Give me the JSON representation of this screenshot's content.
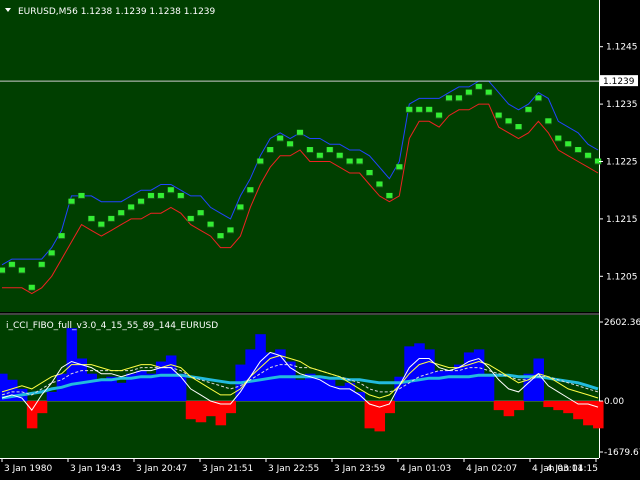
{
  "main": {
    "symbol_title": "EURUSD,M56  1.1238 1.1239 1.1238 1.1239",
    "current_price_label": "1.1239",
    "current_price": 1.1239,
    "price_ticks": [
      {
        "value": 1.1245,
        "label": "1.1245"
      },
      {
        "value": 1.1235,
        "label": "1.1235"
      },
      {
        "value": 1.1225,
        "label": "1.1225"
      },
      {
        "value": 1.1215,
        "label": "1.1215"
      },
      {
        "value": 1.1205,
        "label": "1.1205"
      }
    ]
  },
  "indicator": {
    "title": "i_CCI_FIBO_full_v3.0_4_15_55_89_144_EURUSD",
    "ticks": [
      {
        "value": 2602.36,
        "label": "2602.36"
      },
      {
        "value": 0.0,
        "label": "0.00"
      },
      {
        "value": -1679.67,
        "label": "-1679.67"
      }
    ]
  },
  "time_ticks": [
    "3 Jan 1980",
    "3 Jan 19:43",
    "3 Jan 20:47",
    "3 Jan 21:51",
    "3 Jan 22:55",
    "3 Jan 23:59",
    "4 Jan 01:03",
    "4 Jan 02:07",
    "4 Jan 03:11",
    "4 Jan 04:15"
  ],
  "colors": {
    "background": "#003f00",
    "axis_background": "#000000",
    "price_green": "#33ee33",
    "price_dark": "#1a5a1a",
    "upper_line": "#2244ff",
    "lower_line": "#ee2222",
    "hist_positive": "#0000ff",
    "hist_negative": "#ff0000",
    "cci_fast": "#ffffff",
    "cci_mid": "#ffff44",
    "cci_dashed": "#dddddd",
    "cci_slow": "#22bbdd"
  },
  "chart_data": [
    {
      "type": "line",
      "name": "price",
      "ylim": [
        1.12,
        1.125
      ],
      "x_index": [
        0,
        10,
        20,
        30,
        40,
        50,
        60,
        70,
        80,
        90,
        100,
        110,
        120,
        130,
        140,
        150,
        160,
        170,
        180,
        190,
        200,
        210,
        220,
        230,
        240,
        250,
        260,
        270,
        280,
        290,
        300,
        310,
        320,
        330,
        340,
        350,
        360,
        370,
        380,
        390,
        400,
        410,
        420,
        430,
        440,
        450,
        460,
        470,
        480,
        490,
        500,
        510,
        520,
        530,
        540,
        550,
        560,
        570,
        580,
        590,
        600
      ],
      "close": [
        1.1206,
        1.1207,
        1.1206,
        1.1203,
        1.1207,
        1.1209,
        1.1212,
        1.1218,
        1.1219,
        1.1215,
        1.1214,
        1.1215,
        1.1216,
        1.1217,
        1.1218,
        1.1219,
        1.1219,
        1.122,
        1.1219,
        1.1215,
        1.1216,
        1.1214,
        1.1212,
        1.1213,
        1.1217,
        1.122,
        1.1225,
        1.1227,
        1.1229,
        1.1228,
        1.123,
        1.1227,
        1.1226,
        1.1227,
        1.1226,
        1.1225,
        1.1225,
        1.1223,
        1.1221,
        1.1219,
        1.1224,
        1.1234,
        1.1234,
        1.1234,
        1.1233,
        1.1236,
        1.1236,
        1.1237,
        1.1238,
        1.1237,
        1.1233,
        1.1232,
        1.1231,
        1.1234,
        1.1236,
        1.1232,
        1.1229,
        1.1228,
        1.1227,
        1.1226,
        1.1225
      ],
      "upper": [
        1.1207,
        1.1208,
        1.1208,
        1.1208,
        1.1208,
        1.121,
        1.1213,
        1.1219,
        1.1219,
        1.1219,
        1.1218,
        1.1218,
        1.1218,
        1.1219,
        1.122,
        1.122,
        1.1221,
        1.1221,
        1.122,
        1.1219,
        1.1219,
        1.1217,
        1.1216,
        1.1215,
        1.1219,
        1.1222,
        1.1226,
        1.1229,
        1.123,
        1.1229,
        1.123,
        1.1229,
        1.1229,
        1.1228,
        1.1228,
        1.1227,
        1.1227,
        1.1226,
        1.1224,
        1.1222,
        1.1225,
        1.1235,
        1.1236,
        1.1236,
        1.1236,
        1.1237,
        1.1238,
        1.1238,
        1.1239,
        1.1239,
        1.1237,
        1.1235,
        1.1234,
        1.1235,
        1.1237,
        1.1236,
        1.1232,
        1.1231,
        1.123,
        1.1228,
        1.1227
      ],
      "lower": [
        1.1203,
        1.1203,
        1.1203,
        1.1202,
        1.1203,
        1.1205,
        1.1208,
        1.1211,
        1.1214,
        1.1213,
        1.1212,
        1.1213,
        1.1214,
        1.1215,
        1.1215,
        1.1216,
        1.1216,
        1.1217,
        1.1216,
        1.1214,
        1.1213,
        1.1212,
        1.121,
        1.121,
        1.1212,
        1.1217,
        1.1221,
        1.1224,
        1.1226,
        1.1226,
        1.1227,
        1.1225,
        1.1225,
        1.1225,
        1.1224,
        1.1223,
        1.1223,
        1.1221,
        1.1219,
        1.1218,
        1.1219,
        1.1229,
        1.1232,
        1.1232,
        1.1231,
        1.1233,
        1.1234,
        1.1234,
        1.1235,
        1.1235,
        1.1231,
        1.123,
        1.1229,
        1.123,
        1.1232,
        1.123,
        1.1227,
        1.1226,
        1.1225,
        1.1224,
        1.1223
      ]
    },
    {
      "type": "area",
      "name": "cci",
      "ylim": [
        -1679.67,
        2602.36
      ],
      "x_index": [
        0,
        10,
        20,
        30,
        40,
        50,
        60,
        70,
        80,
        90,
        100,
        110,
        120,
        130,
        140,
        150,
        160,
        170,
        180,
        190,
        200,
        210,
        220,
        230,
        240,
        250,
        260,
        270,
        280,
        290,
        300,
        310,
        320,
        330,
        340,
        350,
        360,
        370,
        380,
        390,
        400,
        410,
        420,
        430,
        440,
        450,
        460,
        470,
        480,
        490,
        500,
        510,
        520,
        530,
        540,
        550,
        560,
        570,
        580,
        590,
        600
      ],
      "histogram": [
        900,
        700,
        400,
        -900,
        -400,
        300,
        900,
        2400,
        1400,
        900,
        700,
        800,
        600,
        900,
        1000,
        900,
        1300,
        1500,
        900,
        -600,
        -700,
        -500,
        -800,
        -400,
        1200,
        1700,
        2200,
        1600,
        1700,
        1300,
        700,
        900,
        800,
        700,
        500,
        600,
        300,
        -900,
        -1000,
        -400,
        800,
        1800,
        1900,
        1700,
        1000,
        1000,
        1200,
        1600,
        1700,
        900,
        -300,
        -500,
        -300,
        900,
        1400,
        -200,
        -300,
        -400,
        -600,
        -800,
        -900
      ],
      "line_fast": [
        100,
        200,
        100,
        -300,
        200,
        600,
        1100,
        1300,
        1200,
        1100,
        900,
        900,
        800,
        900,
        1000,
        1000,
        1100,
        1100,
        800,
        400,
        200,
        0,
        -100,
        -100,
        300,
        800,
        1300,
        1600,
        1500,
        1100,
        900,
        800,
        700,
        500,
        400,
        400,
        200,
        -100,
        -200,
        -100,
        500,
        1100,
        1400,
        1400,
        1100,
        1000,
        1100,
        1300,
        1400,
        1100,
        700,
        400,
        300,
        600,
        900,
        500,
        300,
        100,
        -100,
        -100,
        -200
      ],
      "line_mid": [
        300,
        400,
        500,
        400,
        600,
        800,
        900,
        1200,
        1200,
        1200,
        1100,
        1000,
        1000,
        1100,
        1200,
        1200,
        1100,
        1200,
        1100,
        800,
        600,
        400,
        200,
        200,
        400,
        800,
        1100,
        1400,
        1500,
        1400,
        1300,
        1100,
        1000,
        900,
        800,
        600,
        400,
        200,
        100,
        200,
        500,
        900,
        1200,
        1300,
        1200,
        1100,
        1100,
        1200,
        1300,
        1200,
        1000,
        800,
        600,
        700,
        900,
        800,
        600,
        400,
        300,
        200,
        100
      ],
      "line_dashed": [
        200,
        300,
        300,
        200,
        400,
        600,
        700,
        900,
        1000,
        1000,
        1000,
        1000,
        1000,
        1000,
        1100,
        1100,
        1100,
        1100,
        1000,
        800,
        700,
        600,
        500,
        400,
        500,
        700,
        900,
        1100,
        1200,
        1200,
        1100,
        1100,
        1000,
        900,
        800,
        700,
        600,
        400,
        300,
        300,
        400,
        600,
        800,
        900,
        1000,
        1000,
        1000,
        1100,
        1100,
        1000,
        900,
        800,
        700,
        700,
        800,
        800,
        700,
        600,
        500,
        400,
        300
      ],
      "line_slow": [
        100,
        150,
        200,
        250,
        300,
        400,
        450,
        550,
        600,
        650,
        700,
        700,
        750,
        750,
        800,
        800,
        850,
        850,
        850,
        800,
        750,
        700,
        650,
        600,
        600,
        650,
        700,
        750,
        800,
        800,
        800,
        800,
        800,
        750,
        750,
        700,
        700,
        650,
        600,
        600,
        600,
        650,
        700,
        750,
        750,
        800,
        800,
        800,
        850,
        850,
        850,
        850,
        800,
        800,
        800,
        750,
        700,
        650,
        600,
        500,
        400
      ]
    }
  ]
}
